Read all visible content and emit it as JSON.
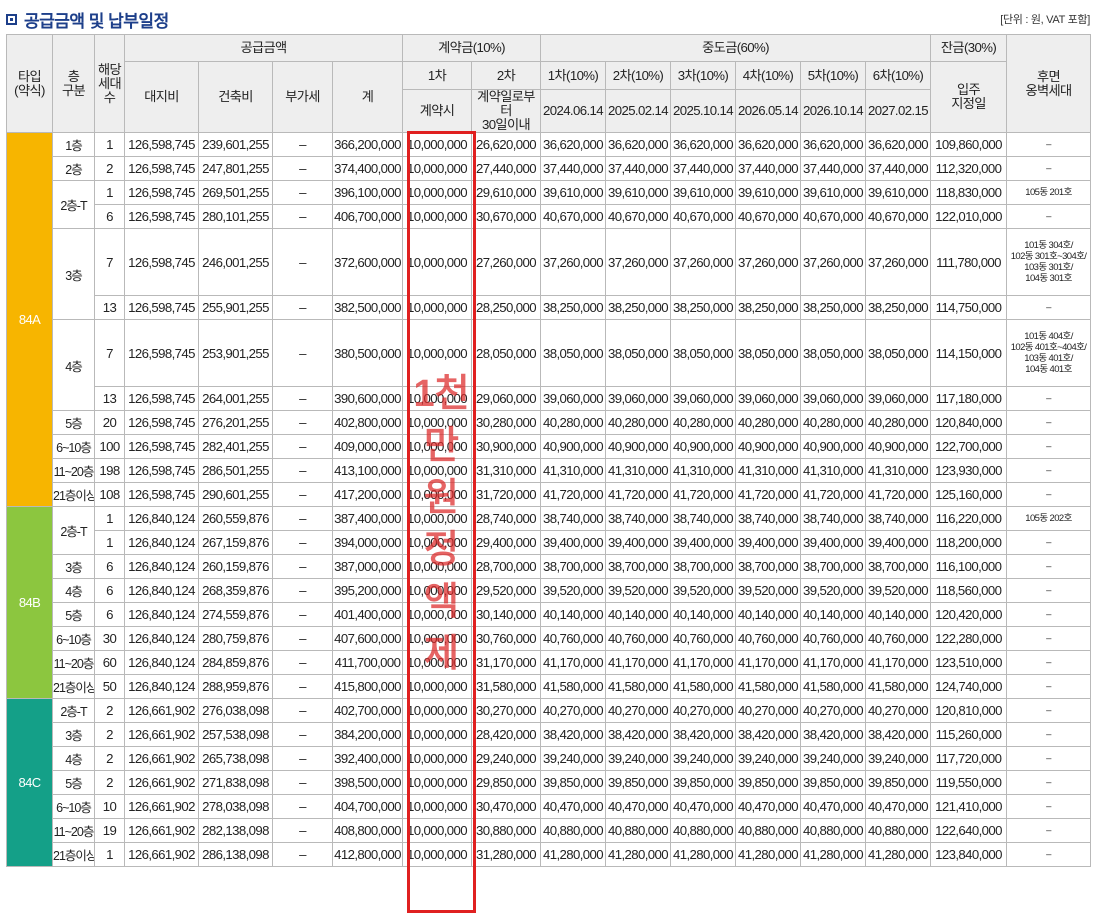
{
  "title": "공급금액 및 납부일정",
  "unit_note": "[단위 : 원, VAT 포함]",
  "headers": {
    "type": "타입\n(약식)",
    "floor": "층\n구분",
    "units": "해당\n세대\n수",
    "supply": "공급금액",
    "land": "대지비",
    "building": "건축비",
    "vat": "부가세",
    "total": "계",
    "contract": "계약금(10%)",
    "contract_1": "1차",
    "contract_2": "2차",
    "contract_1_when": "계약시",
    "contract_2_when": "계약일로부터\n30일이내",
    "middle": "중도금(60%)",
    "middle_labels": [
      "1차(10%)",
      "2차(10%)",
      "3차(10%)",
      "4차(10%)",
      "5차(10%)",
      "6차(10%)"
    ],
    "middle_dates": [
      "2024.06.14",
      "2025.02.14",
      "2025.10.14",
      "2026.05.14",
      "2026.10.14",
      "2027.02.15"
    ],
    "balance": "잔금(30%)",
    "balance_when": "입주\n지정일",
    "rear": "후면\n옹벽세대"
  },
  "overlay_text": "1천만원 정액제",
  "groups": [
    {
      "type": "84A",
      "land": "126,598,745",
      "rows": [
        {
          "floor": "1층",
          "units": "1",
          "building": "239,601,255",
          "total": "366,200,000",
          "c2": "26,620,000",
          "mid": "36,620,000",
          "bal": "109,860,000",
          "note": "–"
        },
        {
          "floor": "2층",
          "units": "2",
          "building": "247,801,255",
          "total": "374,400,000",
          "c2": "27,440,000",
          "mid": "37,440,000",
          "bal": "112,320,000",
          "note": "–"
        },
        {
          "floor": "2층-T",
          "units": "1",
          "building": "269,501,255",
          "total": "396,100,000",
          "c2": "29,610,000",
          "mid": "39,610,000",
          "bal": "118,830,000",
          "note": "105동 201호"
        },
        {
          "floor": "",
          "units": "6",
          "building": "280,101,255",
          "total": "406,700,000",
          "c2": "30,670,000",
          "mid": "40,670,000",
          "bal": "122,010,000",
          "note": "–"
        },
        {
          "floor": "3층",
          "units": "7",
          "building": "246,001,255",
          "total": "372,600,000",
          "c2": "27,260,000",
          "mid": "37,260,000",
          "bal": "111,780,000",
          "note": "101동 304호/\n102동 301호~304호/\n103동 301호/\n104동 301호"
        },
        {
          "floor": "",
          "units": "13",
          "building": "255,901,255",
          "total": "382,500,000",
          "c2": "28,250,000",
          "mid": "38,250,000",
          "bal": "114,750,000",
          "note": "–"
        },
        {
          "floor": "4층",
          "units": "7",
          "building": "253,901,255",
          "total": "380,500,000",
          "c2": "28,050,000",
          "mid": "38,050,000",
          "bal": "114,150,000",
          "note": "101동 404호/\n102동 401호~404호/\n103동 401호/\n104동 401호"
        },
        {
          "floor": "",
          "units": "13",
          "building": "264,001,255",
          "total": "390,600,000",
          "c2": "29,060,000",
          "mid": "39,060,000",
          "bal": "117,180,000",
          "note": "–"
        },
        {
          "floor": "5층",
          "units": "20",
          "building": "276,201,255",
          "total": "402,800,000",
          "c2": "30,280,000",
          "mid": "40,280,000",
          "bal": "120,840,000",
          "note": "–"
        },
        {
          "floor": "6~10층",
          "units": "100",
          "building": "282,401,255",
          "total": "409,000,000",
          "c2": "30,900,000",
          "mid": "40,900,000",
          "bal": "122,700,000",
          "note": "–"
        },
        {
          "floor": "11~20층",
          "units": "198",
          "building": "286,501,255",
          "total": "413,100,000",
          "c2": "31,310,000",
          "mid": "41,310,000",
          "bal": "123,930,000",
          "note": "–"
        },
        {
          "floor": "21층이상",
          "units": "108",
          "building": "290,601,255",
          "total": "417,200,000",
          "c2": "31,720,000",
          "mid": "41,720,000",
          "bal": "125,160,000",
          "note": "–"
        }
      ]
    },
    {
      "type": "84B",
      "land": "126,840,124",
      "rows": [
        {
          "floor": "2층-T",
          "units": "1",
          "building": "260,559,876",
          "total": "387,400,000",
          "c2": "28,740,000",
          "mid": "38,740,000",
          "bal": "116,220,000",
          "note": "105동 202호"
        },
        {
          "floor": "",
          "units": "1",
          "building": "267,159,876",
          "total": "394,000,000",
          "c2": "29,400,000",
          "mid": "39,400,000",
          "bal": "118,200,000",
          "note": "–"
        },
        {
          "floor": "3층",
          "units": "6",
          "building": "260,159,876",
          "total": "387,000,000",
          "c2": "28,700,000",
          "mid": "38,700,000",
          "bal": "116,100,000",
          "note": "–"
        },
        {
          "floor": "4층",
          "units": "6",
          "building": "268,359,876",
          "total": "395,200,000",
          "c2": "29,520,000",
          "mid": "39,520,000",
          "bal": "118,560,000",
          "note": "–"
        },
        {
          "floor": "5층",
          "units": "6",
          "building": "274,559,876",
          "total": "401,400,000",
          "c2": "30,140,000",
          "mid": "40,140,000",
          "bal": "120,420,000",
          "note": "–"
        },
        {
          "floor": "6~10층",
          "units": "30",
          "building": "280,759,876",
          "total": "407,600,000",
          "c2": "30,760,000",
          "mid": "40,760,000",
          "bal": "122,280,000",
          "note": "–"
        },
        {
          "floor": "11~20층",
          "units": "60",
          "building": "284,859,876",
          "total": "411,700,000",
          "c2": "31,170,000",
          "mid": "41,170,000",
          "bal": "123,510,000",
          "note": "–"
        },
        {
          "floor": "21층이상",
          "units": "50",
          "building": "288,959,876",
          "total": "415,800,000",
          "c2": "31,580,000",
          "mid": "41,580,000",
          "bal": "124,740,000",
          "note": "–"
        }
      ]
    },
    {
      "type": "84C",
      "land": "126,661,902",
      "rows": [
        {
          "floor": "2층-T",
          "units": "2",
          "building": "276,038,098",
          "total": "402,700,000",
          "c2": "30,270,000",
          "mid": "40,270,000",
          "bal": "120,810,000",
          "note": "–"
        },
        {
          "floor": "3층",
          "units": "2",
          "building": "257,538,098",
          "total": "384,200,000",
          "c2": "28,420,000",
          "mid": "38,420,000",
          "bal": "115,260,000",
          "note": "–"
        },
        {
          "floor": "4층",
          "units": "2",
          "building": "265,738,098",
          "total": "392,400,000",
          "c2": "29,240,000",
          "mid": "39,240,000",
          "bal": "117,720,000",
          "note": "–"
        },
        {
          "floor": "5층",
          "units": "2",
          "building": "271,838,098",
          "total": "398,500,000",
          "c2": "29,850,000",
          "mid": "39,850,000",
          "bal": "119,550,000",
          "note": "–"
        },
        {
          "floor": "6~10층",
          "units": "10",
          "building": "278,038,098",
          "total": "404,700,000",
          "c2": "30,470,000",
          "mid": "40,470,000",
          "bal": "121,410,000",
          "note": "–"
        },
        {
          "floor": "11~20층",
          "units": "19",
          "building": "282,138,098",
          "total": "408,800,000",
          "c2": "30,880,000",
          "mid": "40,880,000",
          "bal": "122,640,000",
          "note": "–"
        },
        {
          "floor": "21층이상",
          "units": "1",
          "building": "286,138,098",
          "total": "412,800,000",
          "c2": "31,280,000",
          "mid": "41,280,000",
          "bal": "123,840,000",
          "note": "–"
        }
      ]
    }
  ],
  "common": {
    "vat": "–",
    "contract_1": "10,000,000"
  }
}
